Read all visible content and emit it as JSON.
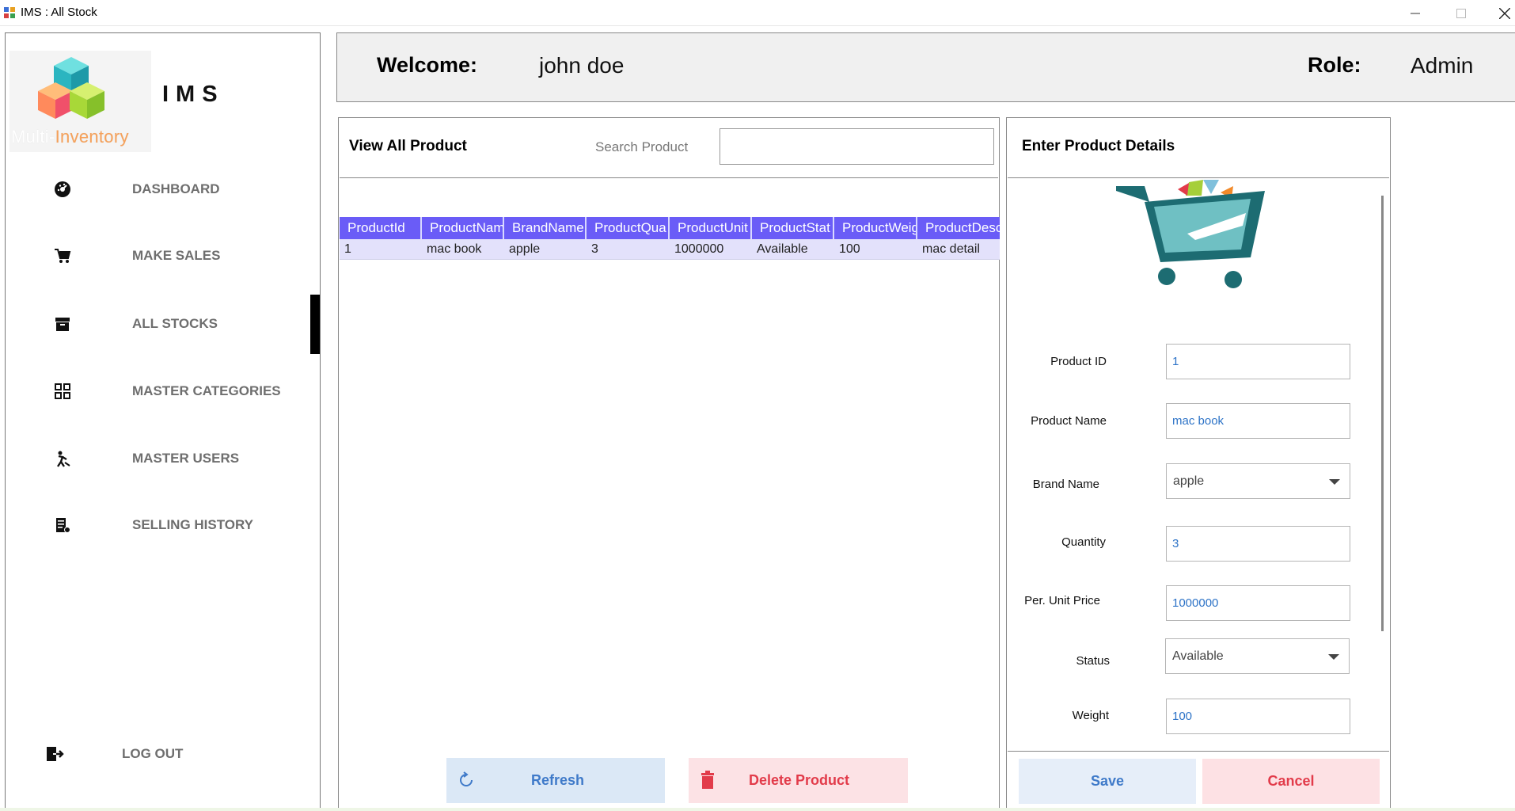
{
  "window": {
    "title": "IMS : All Stock",
    "min_icon": "minimize-icon",
    "max_icon": "maximize-icon",
    "close_icon": "close-icon"
  },
  "sidebar": {
    "logo_caption_1": "Multi-",
    "logo_caption_2": "Inventory",
    "app_name": "IMS",
    "items": [
      {
        "label": "DASHBOARD",
        "icon": "dashboard-icon"
      },
      {
        "label": "MAKE SALES",
        "icon": "cart-icon"
      },
      {
        "label": "ALL STOCKS",
        "icon": "archive-icon",
        "active": true
      },
      {
        "label": "MASTER CATEGORIES",
        "icon": "categories-icon"
      },
      {
        "label": "MASTER USERS",
        "icon": "user-work-icon"
      },
      {
        "label": "SELLING HISTORY",
        "icon": "receipt-icon"
      }
    ],
    "logout": {
      "label": "LOG OUT",
      "icon": "logout-icon"
    }
  },
  "header": {
    "welcome_label": "Welcome:",
    "user_name": "john doe",
    "role_label": "Role:",
    "role_value": "Admin"
  },
  "product_list": {
    "title": "View All Product",
    "search_label": "Search Product",
    "search_value": "",
    "columns": [
      "ProductId",
      "ProductNam",
      "BrandName",
      "ProductQua",
      "ProductUnit",
      "ProductStat",
      "ProductWeig",
      "ProductDesc"
    ],
    "rows": [
      [
        "1",
        "mac book",
        "apple",
        "3",
        "1000000",
        "Available",
        "100",
        "mac detail"
      ]
    ],
    "refresh_label": "Refresh",
    "delete_label": "Delete Product"
  },
  "product_details": {
    "title": "Enter Product Details",
    "fields": {
      "product_id": {
        "label": "Product ID",
        "value": "1"
      },
      "product_name": {
        "label": "Product Name",
        "value": "mac book"
      },
      "brand_name": {
        "label": "Brand Name",
        "value": "apple"
      },
      "quantity": {
        "label": "Quantity",
        "value": "3"
      },
      "unit_price": {
        "label": "Per. Unit Price",
        "value": "1000000"
      },
      "status": {
        "label": "Status",
        "value": "Available"
      },
      "weight": {
        "label": "Weight",
        "value": "100"
      }
    },
    "save_label": "Save",
    "cancel_label": "Cancel"
  },
  "colors": {
    "grid_header": "#6a5cf7",
    "grid_row": "#e3e1fb",
    "save_text": "#3f7ac9",
    "cancel_text": "#e23b4a"
  }
}
